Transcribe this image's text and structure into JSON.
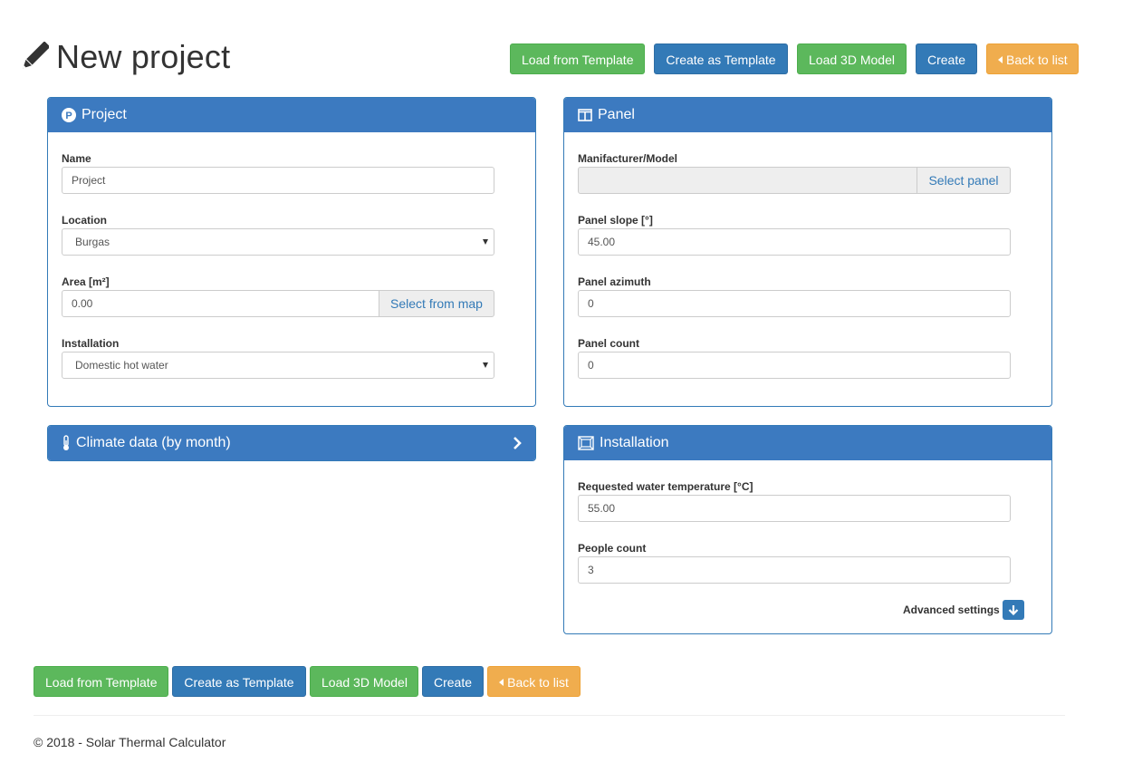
{
  "page": {
    "title": "New project"
  },
  "toolbar": {
    "load_template": "Load from Template",
    "create_template": "Create as Template",
    "load_3d": "Load 3D Model",
    "create": "Create",
    "back": "Back to list"
  },
  "project_panel": {
    "title": "Project",
    "name_label": "Name",
    "name_value": "Project",
    "location_label": "Location",
    "location_value": "Burgas",
    "area_label": "Area [m²]",
    "area_value": "0.00",
    "area_button": "Select from map",
    "installation_label": "Installation",
    "installation_value": "Domestic hot water"
  },
  "climate_panel": {
    "title": "Climate data (by month)"
  },
  "panel_panel": {
    "title": "Panel",
    "manufacturer_label": "Manifacturer/Model",
    "manufacturer_value": "",
    "select_button": "Select panel",
    "slope_label": "Panel slope [°]",
    "slope_value": "45.00",
    "azimuth_label": "Panel azimuth",
    "azimuth_value": "0",
    "count_label": "Panel count",
    "count_value": "0"
  },
  "installation_panel": {
    "title": "Installation",
    "temp_label": "Requested water temperature [°C]",
    "temp_value": "55.00",
    "people_label": "People count",
    "people_value": "3",
    "advanced_label": "Advanced settings"
  },
  "footer": {
    "text": "© 2018 - Solar Thermal Calculator"
  },
  "colors": {
    "primary": "#337ab7",
    "success": "#5cb85c",
    "warning": "#f0ad4e"
  }
}
